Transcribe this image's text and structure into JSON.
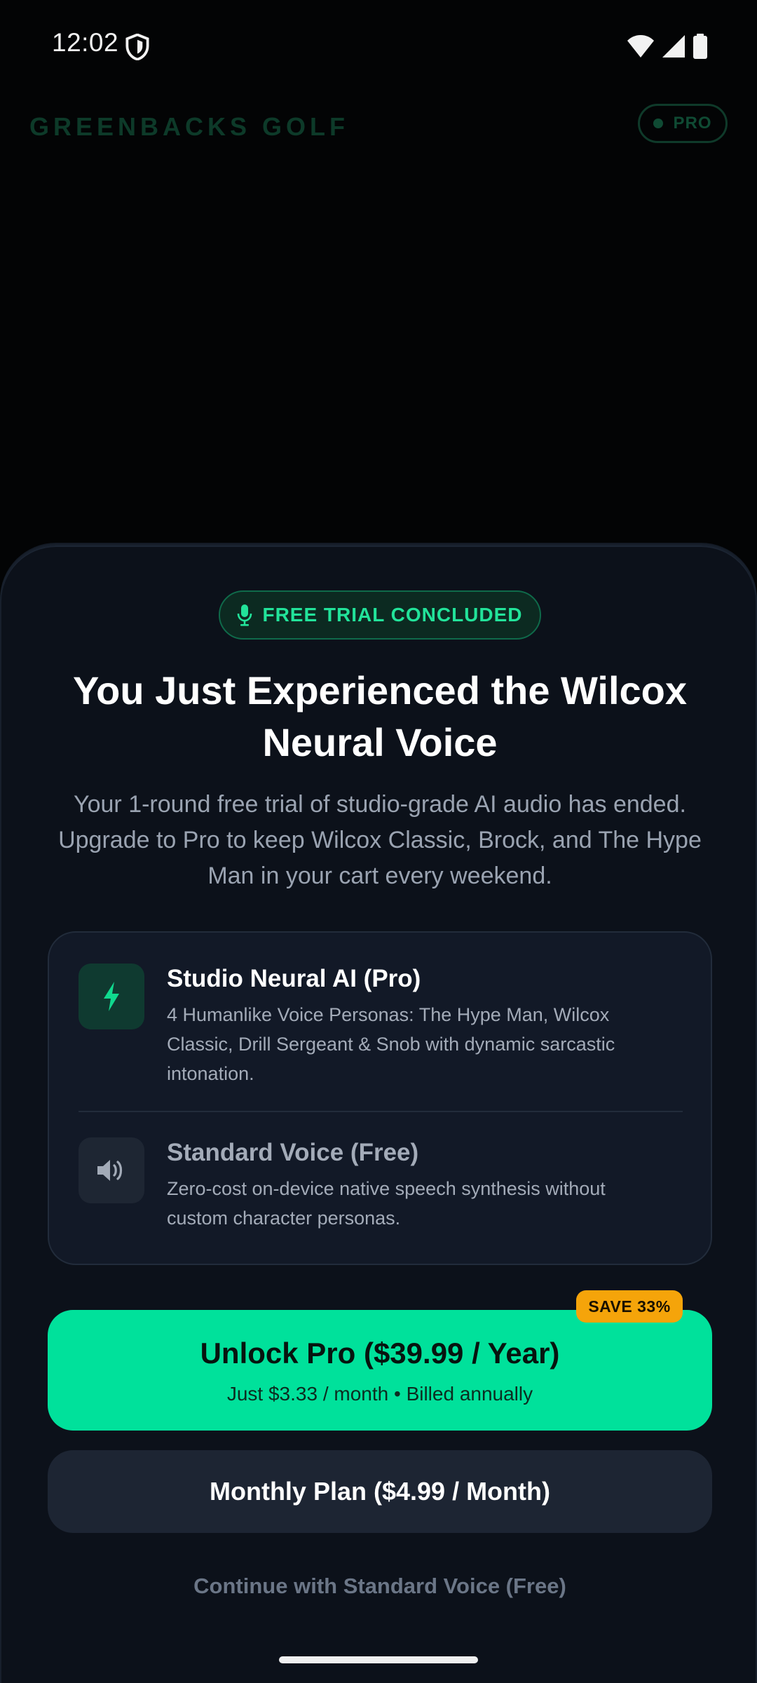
{
  "status_bar": {
    "time": "12:02",
    "icons": [
      "shield-icon",
      "wifi-icon",
      "signal-icon",
      "battery-icon"
    ]
  },
  "app_header": {
    "brand": "GREENBACKS GOLF",
    "pro_badge": "PRO"
  },
  "sheet": {
    "badge": {
      "icon": "microphone-icon",
      "label": "FREE TRIAL CONCLUDED"
    },
    "headline": "You Just Experienced the Wilcox Neural Voice",
    "subtext": "Your 1-round free trial of studio-grade AI audio has ended. Upgrade to Pro to keep Wilcox Classic, Brock, and The Hype Man in your cart every weekend.",
    "features": [
      {
        "icon": "lightning-icon",
        "title": "Studio Neural AI (Pro)",
        "description": "4 Humanlike Voice Personas: The Hype Man, Wilcox Classic, Drill Sergeant & Snob with dynamic sarcastic intonation."
      },
      {
        "icon": "speaker-icon",
        "title": "Standard Voice (Free)",
        "description": "Zero-cost on-device native speech synthesis without custom character personas."
      }
    ],
    "primary_cta": {
      "badge": "SAVE 33%",
      "title": "Unlock Pro ($39.99 / Year)",
      "subtitle": "Just $3.33 / month • Billed annually"
    },
    "secondary_cta": {
      "title": "Monthly Plan ($4.99 / Month)"
    },
    "continue_link": "Continue with Standard Voice (Free)"
  },
  "colors": {
    "background": "#030405",
    "sheet": "#0c111a",
    "accent": "#00e19b",
    "save_badge": "#f5a40a",
    "muted_text": "#9aa3b1"
  }
}
